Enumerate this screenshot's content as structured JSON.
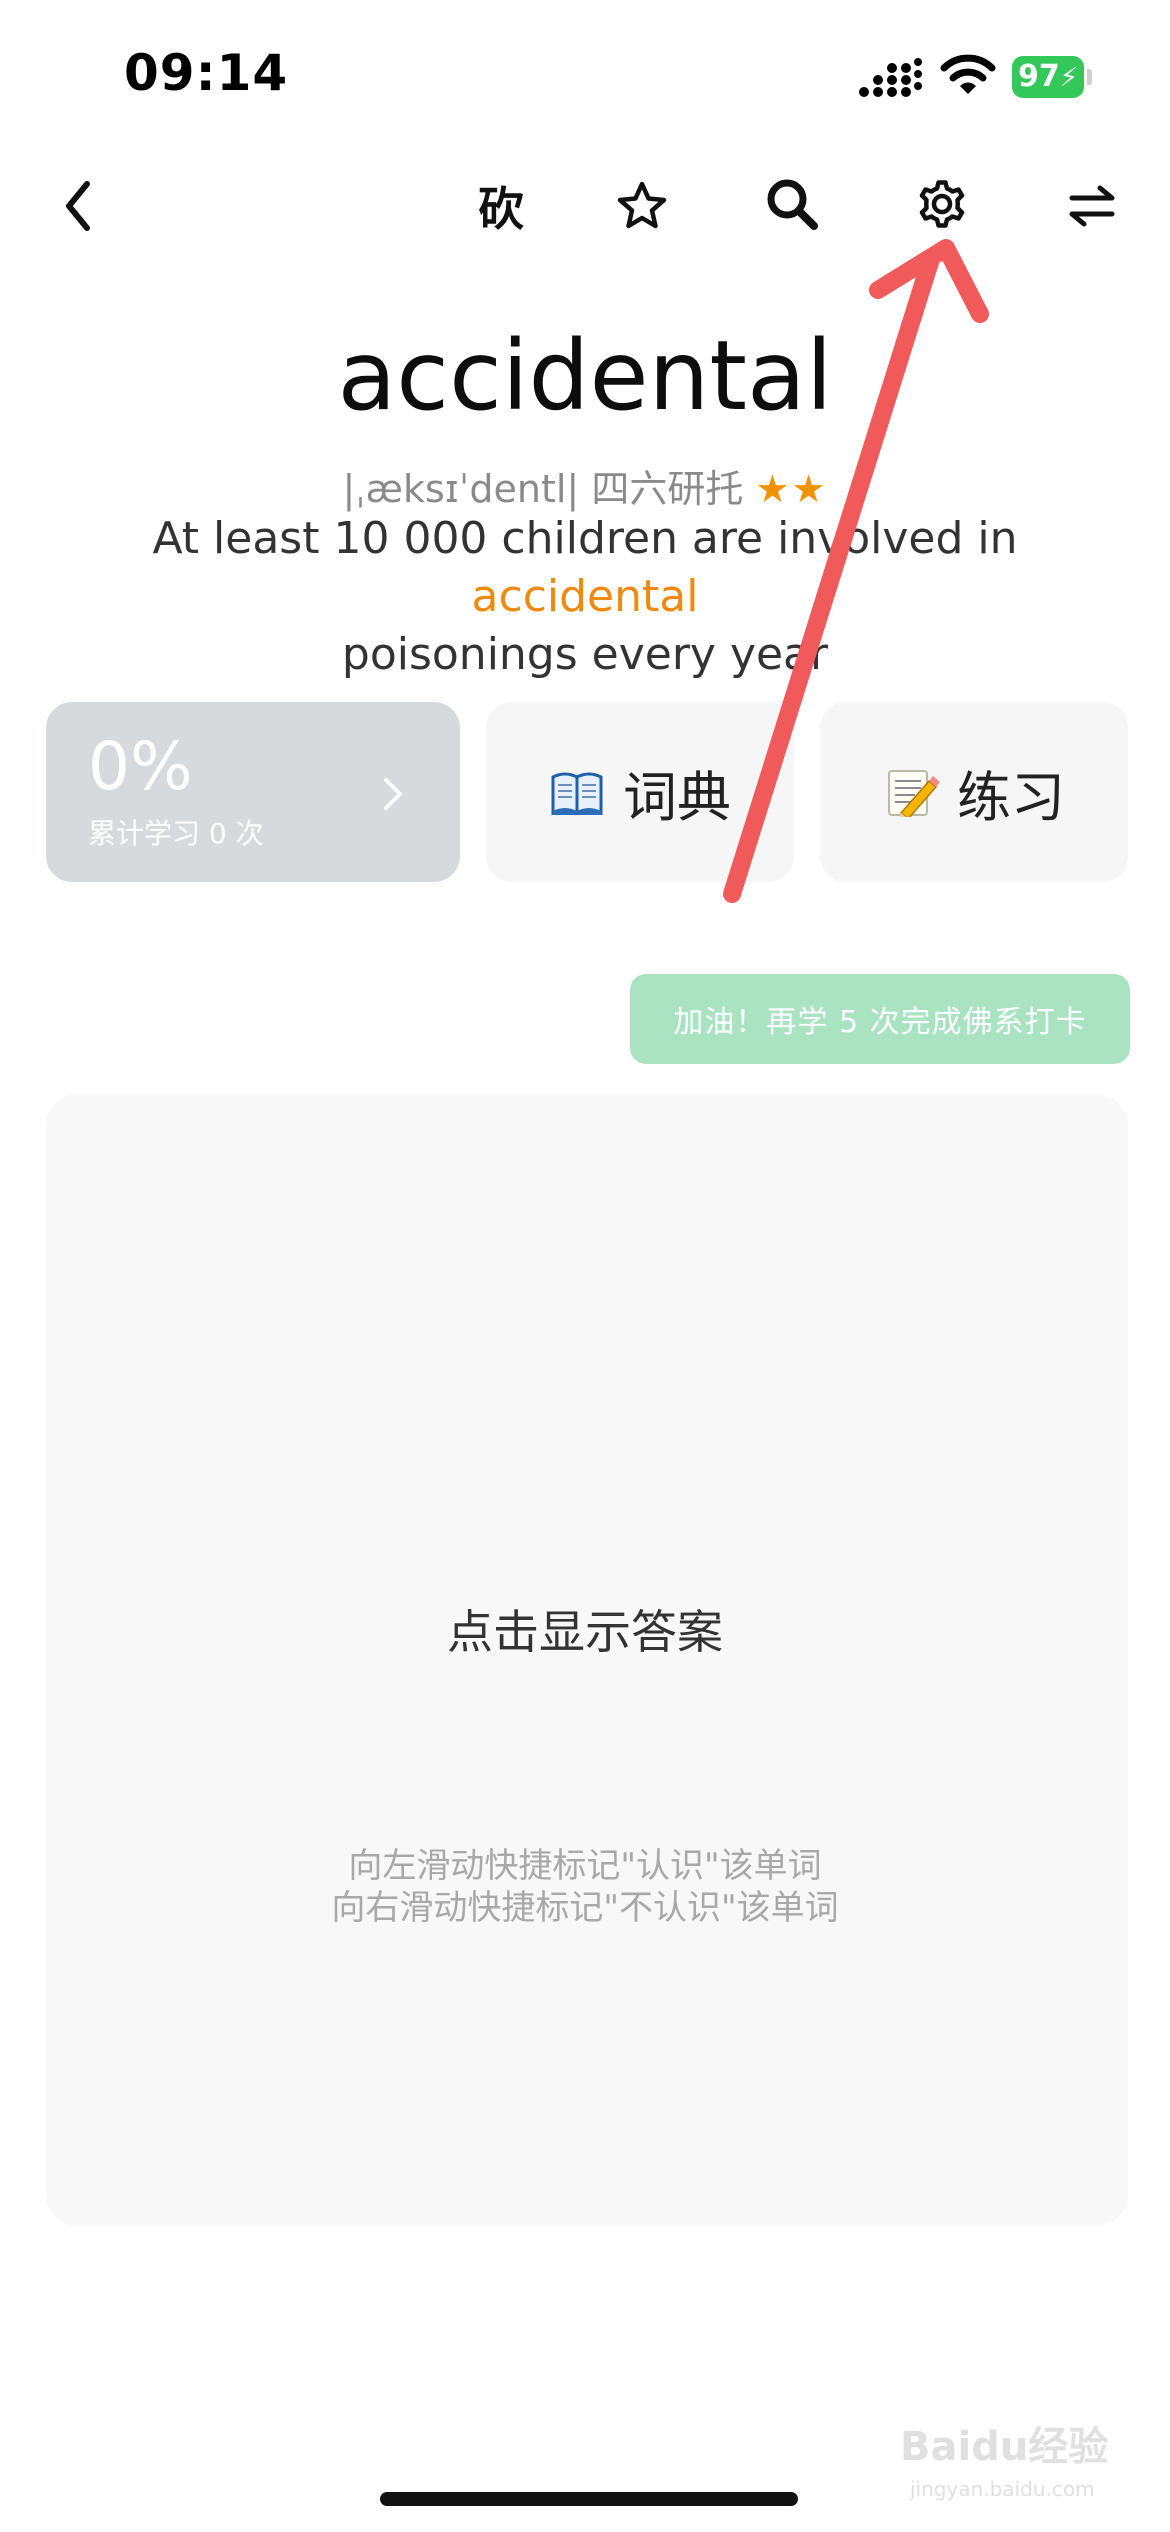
{
  "status_bar": {
    "time": "09:14",
    "battery": "97"
  },
  "nav": {
    "kanji_button": "砍"
  },
  "word": {
    "headword": "accidental",
    "phonetic": "|ˌæksɪˈdentl|",
    "tags": "四六研托",
    "stars": "★★",
    "rating": 2
  },
  "example": {
    "before": "At least 10 000 children are involved in ",
    "highlight": "accidental",
    "after": "poisonings every year"
  },
  "progress": {
    "percent": "0%",
    "value": 0,
    "subtitle": "累计学习 0 次"
  },
  "dictionary": {
    "label": "词典"
  },
  "practice": {
    "label": "练习"
  },
  "encourage": {
    "text": "加油！再学 5 次完成佛系打卡"
  },
  "answer": {
    "prompt": "点击显示答案",
    "hint_left": "向左滑动快捷标记\"认识\"该单词",
    "hint_right": "向右滑动快捷标记\"不认识\"该单词"
  },
  "watermark": {
    "text": "Baidu经验",
    "sub": "jingyan.baidu.com"
  },
  "colors": {
    "accent": "#ee8a10",
    "star": "#f39200",
    "battery": "#34c759",
    "encourage_bg": "#a9e3c2",
    "annotation_arrow": "#f05a5a"
  },
  "icons": [
    "back-chevron-icon",
    "star-outline-icon",
    "search-icon",
    "gear-icon",
    "switch-arrows-icon",
    "chevron-right-icon",
    "book-icon",
    "memo-pencil-icon",
    "red-annotation-arrow"
  ]
}
